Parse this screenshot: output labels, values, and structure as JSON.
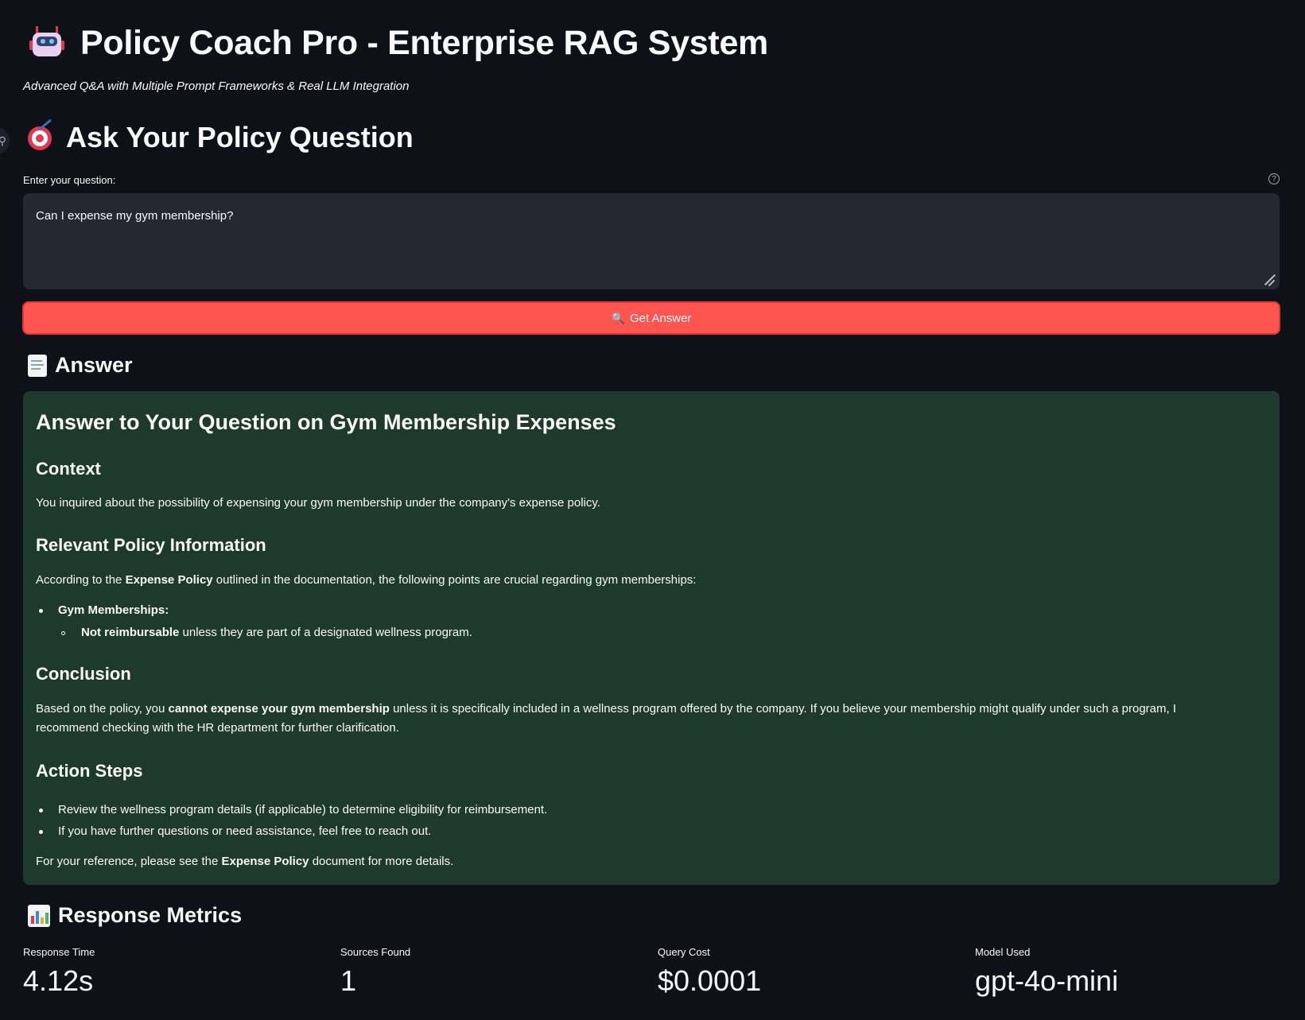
{
  "header": {
    "title": "Policy Coach Pro - Enterprise RAG System",
    "subtitle": "Advanced Q&A with Multiple Prompt Frameworks & Real LLM Integration"
  },
  "ask": {
    "heading": "Ask Your Policy Question",
    "label": "Enter your question:",
    "value": "Can I expense my gym membership?",
    "button_label": "Get Answer"
  },
  "answer": {
    "heading": "Answer",
    "title": "Answer to Your Question on Gym Membership Expenses",
    "context_heading": "Context",
    "context_text": "You inquired about the possibility of expensing your gym membership under the company's expense policy.",
    "relevant_heading": "Relevant Policy Information",
    "relevant_pre": "According to the ",
    "relevant_bold": "Expense Policy",
    "relevant_post": " outlined in the documentation, the following points are crucial regarding gym memberships:",
    "bullet_label": "Gym Memberships:",
    "sub_bold": "Not reimbursable",
    "sub_text": " unless they are part of a designated wellness program.",
    "conclusion_heading": "Conclusion",
    "conclusion_pre": "Based on the policy, you ",
    "conclusion_bold": "cannot expense your gym membership",
    "conclusion_post": " unless it is specifically included in a wellness program offered by the company. If you believe your membership might qualify under such a program, I recommend checking with the HR department for further clarification.",
    "action_heading": "Action Steps",
    "action_items": [
      "Review the wellness program details (if applicable) to determine eligibility for reimbursement.",
      "If you have further questions or need assistance, feel free to reach out."
    ],
    "ref_pre": "For your reference, please see the ",
    "ref_bold": "Expense Policy",
    "ref_post": " document for more details."
  },
  "metrics": {
    "heading": "Response Metrics",
    "items": [
      {
        "label": "Response Time",
        "value": "4.12s"
      },
      {
        "label": "Sources Found",
        "value": "1"
      },
      {
        "label": "Query Cost",
        "value": "$0.0001"
      },
      {
        "label": "Model Used",
        "value": "gpt-4o-mini"
      }
    ]
  },
  "icons": {
    "title": "robot-icon",
    "ask": "target-icon",
    "button": "magnifier-icon",
    "answer": "memo-icon",
    "metrics": "bar-chart-icon"
  },
  "colors": {
    "background": "#0e1117",
    "primary_button": "#ff544f",
    "answer_box": "#1e3a2c",
    "input_bg": "#262730"
  }
}
